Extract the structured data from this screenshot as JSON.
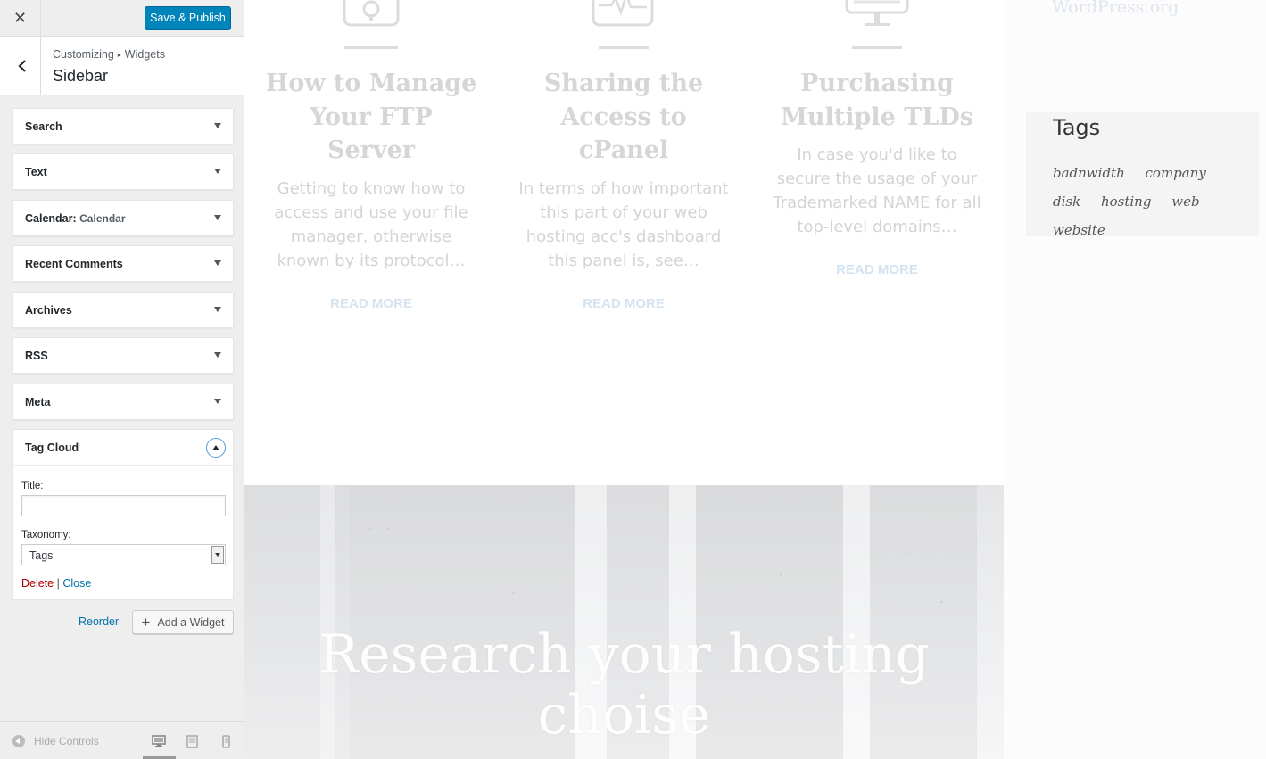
{
  "customizer": {
    "close_label": "✕",
    "publish_label": "Save & Publish",
    "breadcrumb": {
      "root": "Customizing",
      "separator": "▸",
      "current": "Widgets"
    },
    "section_title": "Sidebar",
    "widgets": [
      {
        "title": "Search",
        "instance": ""
      },
      {
        "title": "Text",
        "instance": ""
      },
      {
        "title": "Calendar",
        "instance": "Calendar"
      },
      {
        "title": "Recent Comments",
        "instance": ""
      },
      {
        "title": "Archives",
        "instance": ""
      },
      {
        "title": "RSS",
        "instance": ""
      },
      {
        "title": "Meta",
        "instance": ""
      }
    ],
    "tag_cloud": {
      "title": "Tag Cloud",
      "title_field_label": "Title:",
      "title_field_value": "",
      "taxonomy_label": "Taxonomy:",
      "taxonomy_value": "Tags",
      "delete_label": "Delete",
      "link_separator": "|",
      "close_label": "Close"
    },
    "reorder_label": "Reorder",
    "add_widget_label": "Add a Widget",
    "hide_controls_label": "Hide Controls",
    "devices": [
      "desktop-icon",
      "tablet-icon",
      "mobile-icon"
    ],
    "active_device": "desktop"
  },
  "preview": {
    "posts": [
      {
        "icon": "lock-monitor-icon",
        "title": "How to Manage Your FTP Server",
        "excerpt": "Getting to know how to access and use your file manager, otherwise known by its protocol…",
        "read_more": "READ MORE"
      },
      {
        "icon": "pulse-monitor-icon",
        "title": "Sharing the Access to cPanel",
        "excerpt": "In terms of how important this part of your web hosting acc's dashboard this panel is, see…",
        "read_more": "READ MORE"
      },
      {
        "icon": "desktop-monitor-icon",
        "title": "Purchasing Multiple TLDs",
        "excerpt": "In case you'd like to secure the usage of your Trademarked NAME for all top-level domains…",
        "read_more": "READ MORE"
      }
    ],
    "hero_title": "Research your hosting choise",
    "sidebar_link": "WordPress.org",
    "tags_widget": {
      "title": "Tags",
      "tags": [
        "badnwidth",
        "company",
        "disk",
        "hosting",
        "web",
        "website"
      ]
    }
  },
  "colors": {
    "primary_button": "#0085ba",
    "link": "#0073aa",
    "delete": "#aa0000",
    "faded_title": "#d6d6d6",
    "read_more": "#d5e3f0"
  }
}
